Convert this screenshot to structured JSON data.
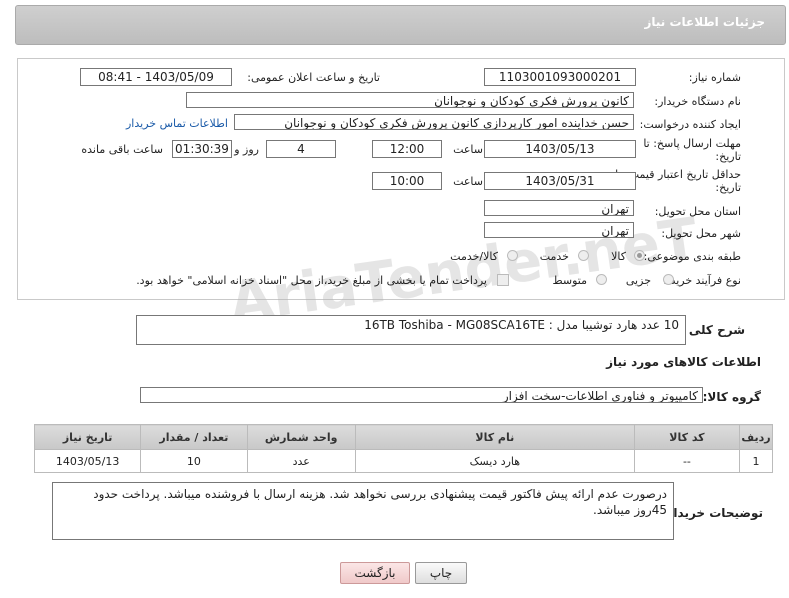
{
  "header": {
    "title": "جزئیات اطلاعات نیاز"
  },
  "fields": {
    "need_number_label": "شماره نیاز:",
    "need_number": "1103001093000201",
    "announce_label": "تاریخ و ساعت اعلان عمومی:",
    "announce_value": "1403/05/09 - 08:41",
    "buyer_org_label": "نام دستگاه خریدار:",
    "buyer_org": "کانون پرورش فکری کودکان و نوجوانان",
    "requester_label": "ایجاد کننده درخواست:",
    "requester": "حسن خداینده امور کارپردازی  کانون پرورش فکری کودکان و نوجوانان",
    "contact_link": "اطلاعات تماس خریدار",
    "deadline_label": "مهلت ارسال پاسخ: تا تاریخ:",
    "deadline_date": "1403/05/13",
    "time_label": "ساعت",
    "deadline_time": "12:00",
    "days_value": "4",
    "days_label": "روز و",
    "remaining_time": "01:30:39",
    "remaining_label": "ساعت باقی مانده",
    "validity_label": "حداقل تاریخ اعتبار قیمت: تا تاریخ:",
    "validity_date": "1403/05/31",
    "validity_time": "10:00",
    "province_label": "استان محل تحویل:",
    "province": "تهران",
    "city_label": "شهر محل تحویل:",
    "city": "تهران",
    "category_label": "طبقه بندی موضوعی:",
    "category_options": [
      "کالا",
      "خدمت",
      "کالا/خدمت"
    ],
    "process_label": "نوع فرآیند خرید :",
    "process_options": [
      "جزیی",
      "متوسط"
    ],
    "payment_note": "پرداخت تمام یا بخشی از مبلغ خرید،از محل \"اسناد خزانه اسلامی\" خواهد بود."
  },
  "description": {
    "label": "شرح کلی نیاز:",
    "text": "10 عدد هارد توشیبا مدل : 16TB Toshiba - MG08SCA16TE"
  },
  "goods_section": {
    "title": "اطلاعات کالاهای مورد نیاز",
    "group_label": "گروه کالا:",
    "group_value": "کامپیوتر و فناوری اطلاعات-سخت افزار"
  },
  "table": {
    "headers": [
      "ردیف",
      "کد کالا",
      "نام کالا",
      "واحد شمارش",
      "تعداد / مقدار",
      "تاریخ نیاز"
    ],
    "rows": [
      [
        "1",
        "--",
        "هارد دیسک",
        "عدد",
        "10",
        "1403/05/13"
      ]
    ]
  },
  "buyer_notes": {
    "label": "توضیحات خریدار:",
    "text": "درصورت عدم ارائه پیش فاکتور قیمت پیشنهادی بررسی نخواهد شد. هزینه ارسال با فروشنده میباشد. پرداخت حدود 45روز میباشد."
  },
  "buttons": {
    "print": "چاپ",
    "back": "بازگشت"
  },
  "watermark": "AriaTender.neT"
}
